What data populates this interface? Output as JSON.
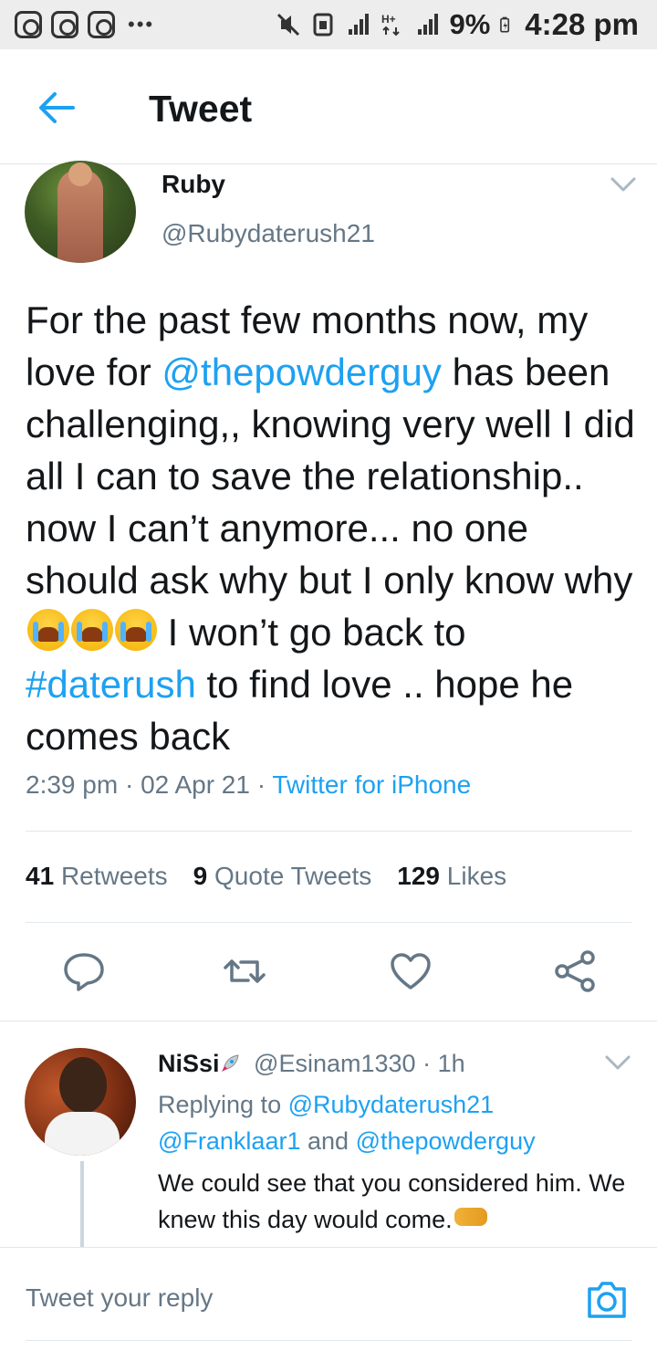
{
  "status_bar": {
    "battery": "9%",
    "time": "4:28 pm"
  },
  "header": {
    "title": "Tweet"
  },
  "tweet": {
    "author_name": "Ruby",
    "author_handle": "@Rubydaterush21",
    "text_part1": "For the past few months now, my love for ",
    "mention": "@thepowderguy",
    "text_part2": " has been challenging,, knowing very well I did all I can to save the relationship.. now I can’t anymore... no one should ask why but I only know why ",
    "text_part3": " I won’t go back to ",
    "hashtag": "#daterush",
    "text_part4": " to find love .. hope he comes back",
    "time": "2:39 pm",
    "date": "02 Apr 21",
    "source": "Twitter for iPhone"
  },
  "stats": {
    "retweets_count": "41",
    "retweets_label": "Retweets",
    "quotes_count": "9",
    "quotes_label": "Quote Tweets",
    "likes_count": "129",
    "likes_label": "Likes"
  },
  "reply": {
    "name": "NiSsi",
    "handle": "@Esinam1330",
    "age": "1h",
    "replying_to_label": "Replying to",
    "reply_to_1": "@Rubydaterush21",
    "reply_to_2": "@Franklaar1",
    "and_label": "and",
    "reply_to_3": "@thepowderguy",
    "text": "We could see that you considered him. We knew this day would come."
  },
  "composer": {
    "placeholder": "Tweet your reply"
  },
  "colors": {
    "accent": "#1da1f2",
    "secondary_text": "#657786",
    "primary_text": "#14171a"
  }
}
